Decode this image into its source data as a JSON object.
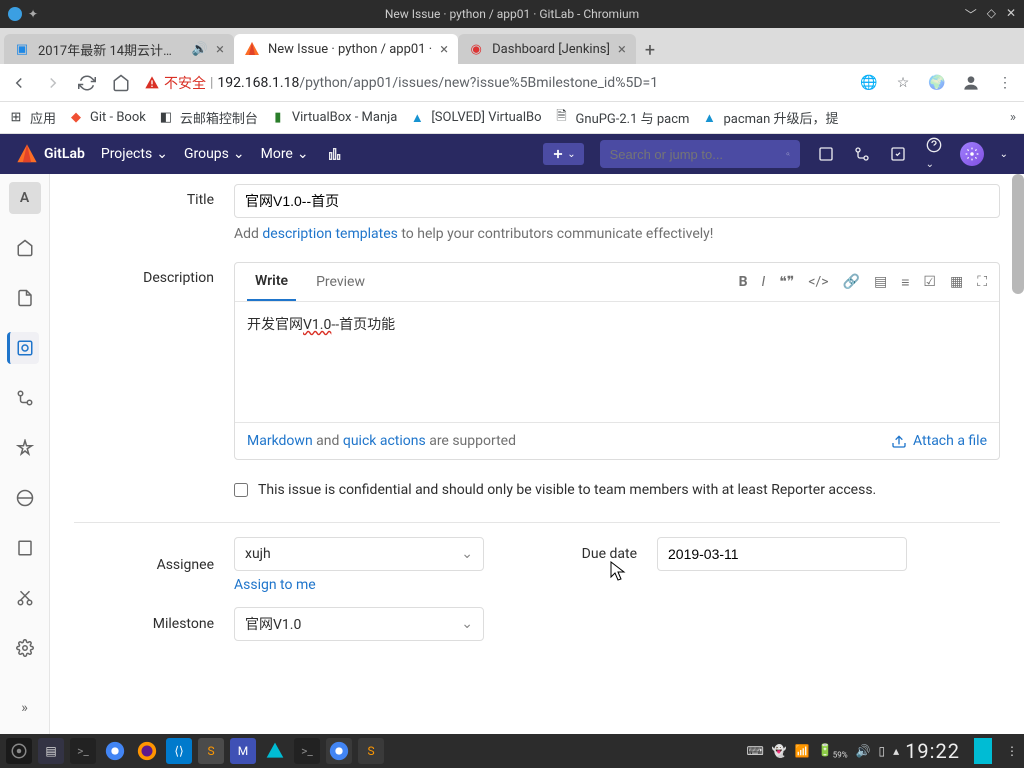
{
  "window": {
    "title": "New Issue · python / app01 · GitLab - Chromium"
  },
  "tabs": [
    {
      "label": "2017年最新 14期云计算与",
      "active": false,
      "audio": true
    },
    {
      "label": "New Issue · python / app01 · ",
      "active": true
    },
    {
      "label": "Dashboard [Jenkins]",
      "active": false
    }
  ],
  "url": {
    "danger_label": "不安全",
    "host": "192.168.1.18",
    "path": "/python/app01/issues/new?issue%5Bmilestone_id%5D=1"
  },
  "bookmarks": [
    {
      "label": "应用"
    },
    {
      "label": "Git - Book"
    },
    {
      "label": "云邮箱控制台"
    },
    {
      "label": "VirtualBox - Manja"
    },
    {
      "label": "[SOLVED] VirtualBo"
    },
    {
      "label": "GnuPG-2.1 与 pacm"
    },
    {
      "label": "pacman 升级后，提"
    }
  ],
  "gitlab_nav": {
    "brand": "GitLab",
    "items": [
      "Projects",
      "Groups",
      "More"
    ],
    "search_placeholder": "Search or jump to..."
  },
  "sidebar": {
    "avatar_letter": "A"
  },
  "form": {
    "title_label": "Title",
    "title_value": "官网V1.0--首页",
    "desc_hint_pre": "Add ",
    "desc_hint_link": "description templates",
    "desc_hint_post": " to help your contributors communicate effectively!",
    "description_label": "Description",
    "tabs": {
      "write": "Write",
      "preview": "Preview"
    },
    "description_value": "开发官网V1.0--首页功能",
    "markdown_link": "Markdown",
    "md_mid": " and ",
    "quick_link": "quick actions",
    "md_post": " are supported",
    "attach_label": "Attach a file",
    "confidential_label": "This issue is confidential and should only be visible to team members with at least Reporter access.",
    "assignee_label": "Assignee",
    "assignee_value": "xujh",
    "assign_me": "Assign to me",
    "due_label": "Due date",
    "due_value": "2019-03-11",
    "milestone_label": "Milestone",
    "milestone_value": "官网V1.0"
  },
  "taskbar": {
    "battery": "59%",
    "clock": "19:22"
  }
}
